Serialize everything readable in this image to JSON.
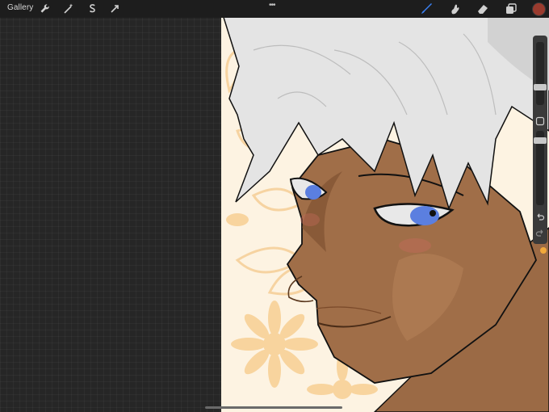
{
  "toolbar": {
    "gallery_label": "Gallery",
    "actions_icon": "wrench-icon",
    "adjustments_icon": "magic-wand-icon",
    "selection_icon": "selection-s-icon",
    "transform_icon": "arrow-cursor-icon",
    "brush_icon": "brush-icon",
    "smudge_icon": "smudge-icon",
    "eraser_icon": "eraser-icon",
    "layers_icon": "layers-icon",
    "more_label": "•••",
    "active_color": "#9a3b2e",
    "accent_color": "#3b82f6"
  },
  "sidebar": {
    "brush_size_level": 0.55,
    "opacity_level": 0.7,
    "modify_icon": "square-icon",
    "undo_icon": "undo-icon",
    "redo_icon": "redo-icon"
  },
  "canvas": {
    "artwork": "digital-painting",
    "background_color": "#fdf3e2",
    "pattern_color": "#f9d9a6"
  }
}
